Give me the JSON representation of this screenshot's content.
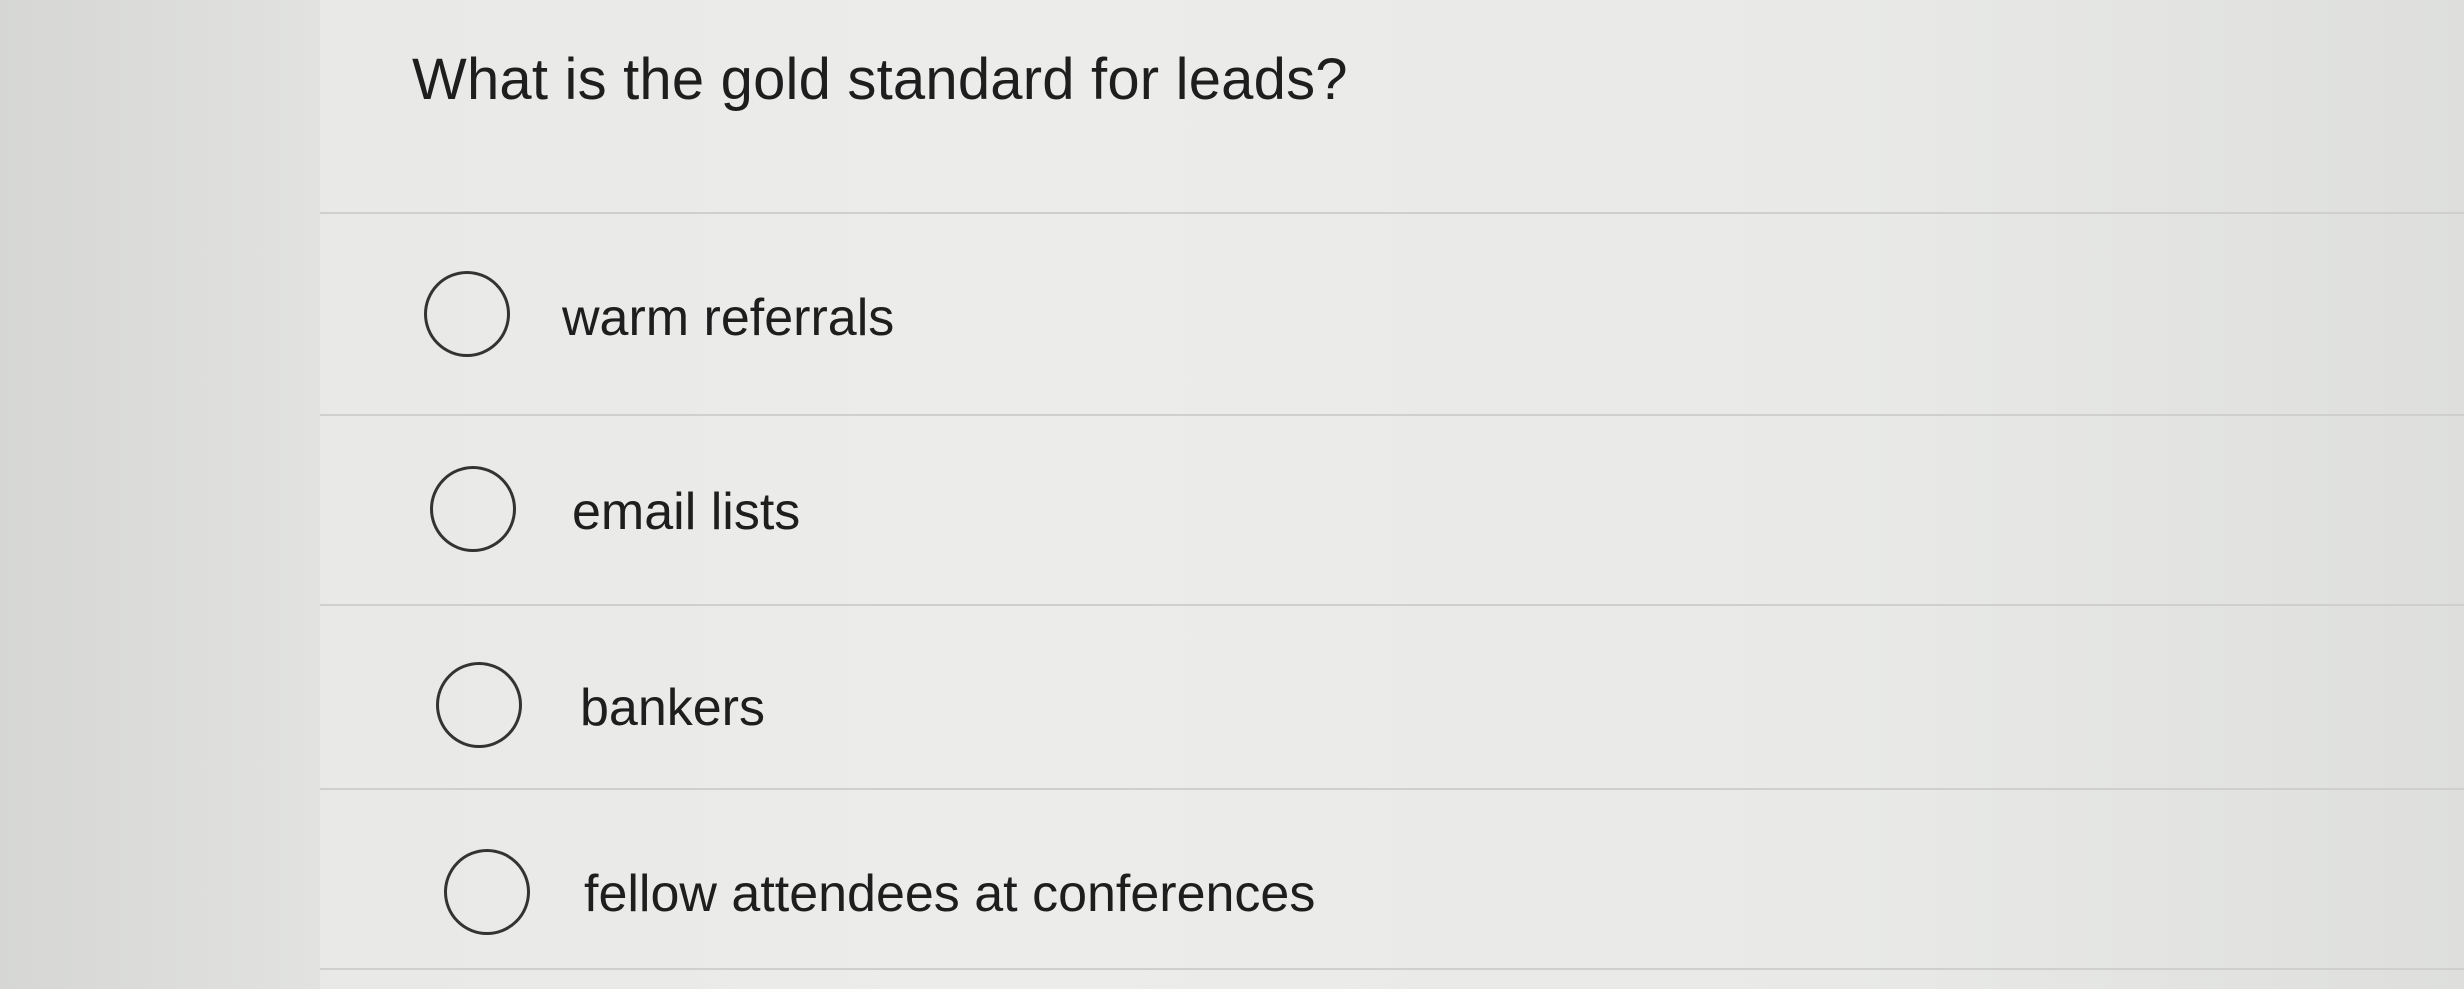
{
  "question": {
    "text": "What is the gold standard for leads?"
  },
  "options": [
    {
      "label": "warm referrals",
      "selected": false
    },
    {
      "label": "email lists",
      "selected": false
    },
    {
      "label": "bankers",
      "selected": false
    },
    {
      "label": "fellow attendees at conferences",
      "selected": false
    }
  ]
}
